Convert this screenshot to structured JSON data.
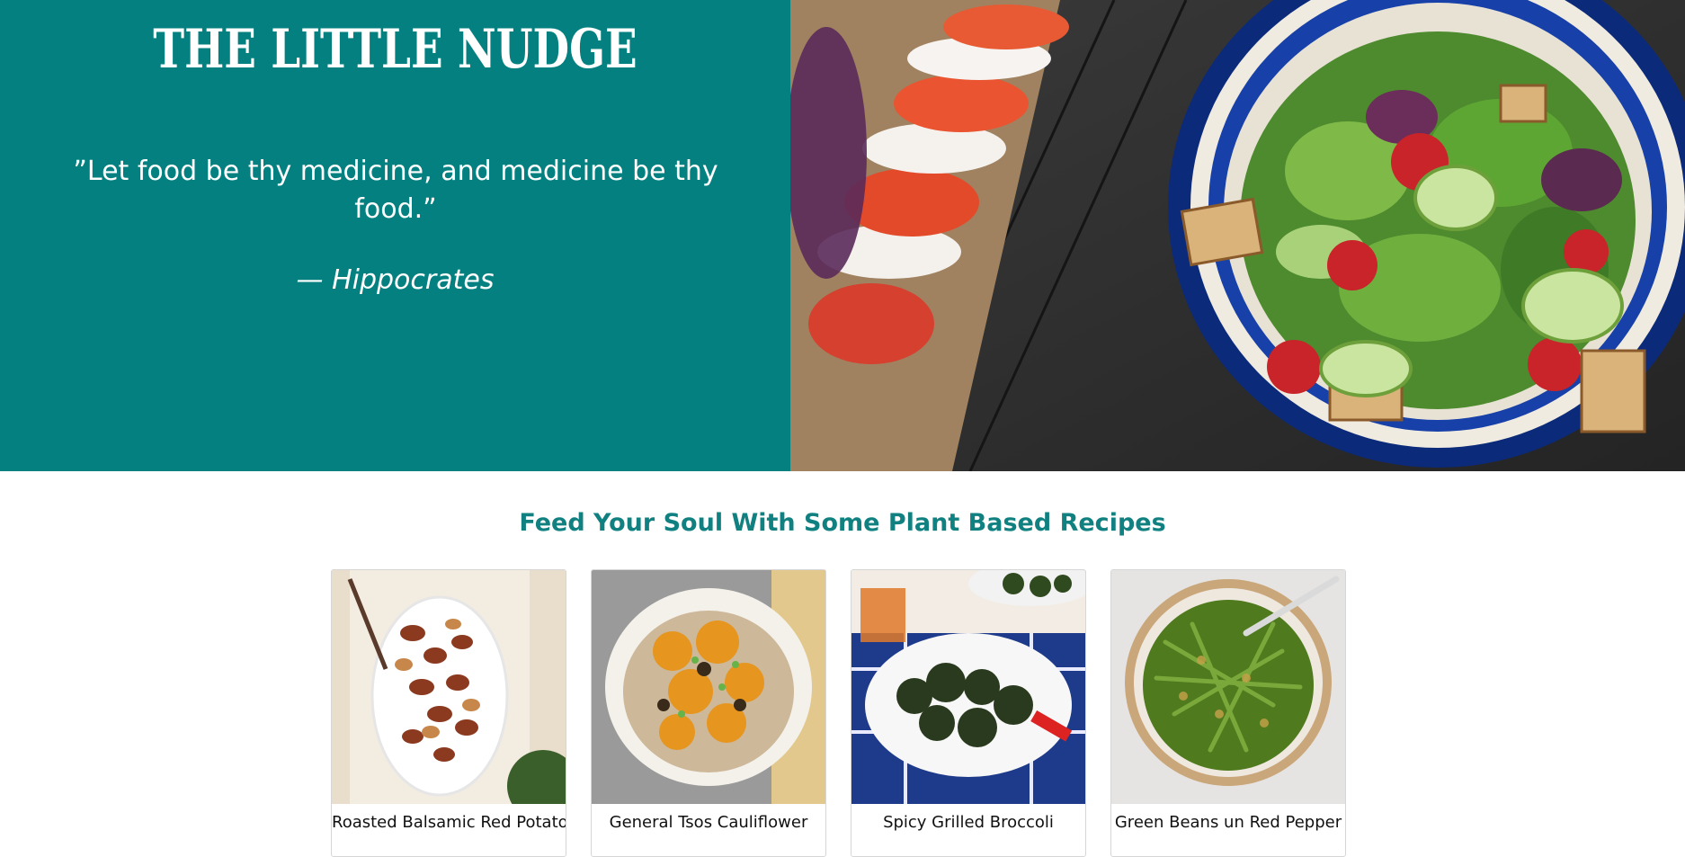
{
  "hero": {
    "brand": "THE LITTLE NUDGE",
    "quote": "”Let food be thy medicine, and medicine be thy food.”",
    "author": "— Hippocrates",
    "color": "#048080"
  },
  "section": {
    "title": "Feed Your Soul With Some Plant Based Recipes",
    "title_color": "#108080"
  },
  "recipes": [
    {
      "title": "Roasted Balsamic Red Potatoes"
    },
    {
      "title": "General Tsos Cauliflower"
    },
    {
      "title": "Spicy Grilled Broccoli"
    },
    {
      "title": "Green Beans un Red Pepper"
    }
  ]
}
